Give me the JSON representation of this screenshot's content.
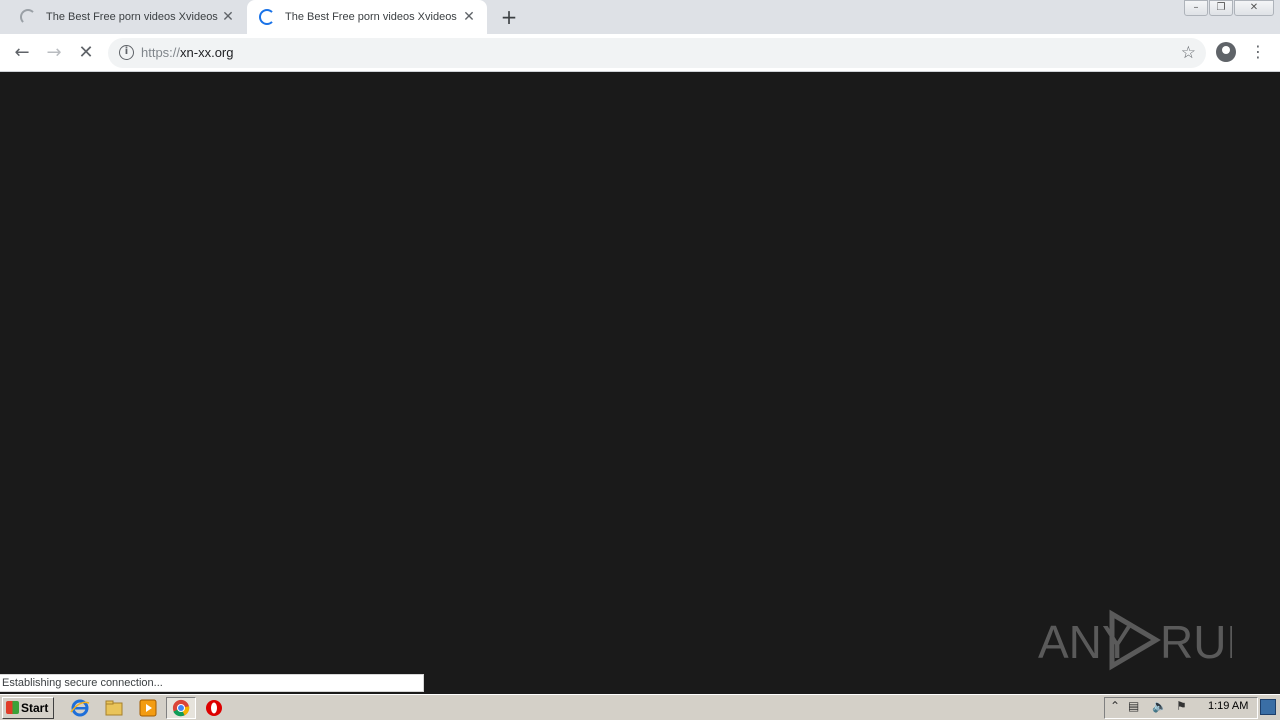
{
  "browser": {
    "tabs": [
      {
        "title": "The Best Free porn videos Xvideos",
        "state": "loading"
      },
      {
        "title": "The Best Free porn videos Xvideos",
        "state": "loading-active"
      }
    ],
    "new_tab_glyph": "+",
    "close_glyph": "✕",
    "window_controls": {
      "minimize": "–",
      "restore": "❐",
      "close": "✕"
    },
    "url_scheme": "https://",
    "url_host": "xn-xx.org",
    "status_text": "Establishing secure connection..."
  },
  "watermark": {
    "text": "ANY RUN"
  },
  "taskbar": {
    "start_label": "Start",
    "pinned": [
      "internet-explorer-icon",
      "file-explorer-icon",
      "media-player-icon",
      "chrome-icon",
      "opera-icon"
    ],
    "clock": "1:19 AM"
  },
  "colors": {
    "tabstrip_bg": "#dee1e6",
    "content_bg": "#1a1a1a",
    "spinner_active": "#1a73e8",
    "taskbar_bg": "#d4d0c8"
  }
}
